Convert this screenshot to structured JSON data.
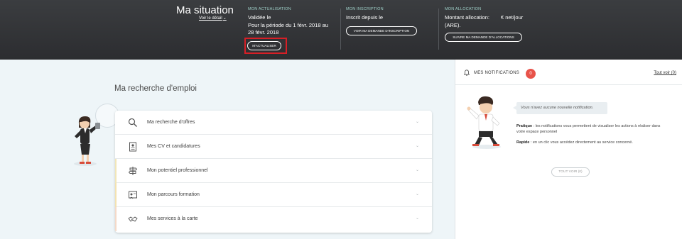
{
  "situation": {
    "title": "Ma situation",
    "detail_link": "Voir le détail",
    "actualisation": {
      "heading": "MON ACTUALISATION",
      "line1": "Validée le",
      "line2": "Pour la période du 1 févr. 2018 au",
      "line3": "28 févr. 2018",
      "button": "M'ACTUALISER"
    },
    "inscription": {
      "heading": "MON INSCRIPTION",
      "line1": "Inscrit depuis le",
      "button": "VOIR MA DEMANDE D'INSCRIPTION"
    },
    "allocation": {
      "heading": "MON ALLOCATION",
      "line1": "Montant allocation:",
      "line1b": "€ net/jour",
      "line2": "(ARE).",
      "button": "SUIVRE MA DEMANDE D'ALLOCATIONS"
    }
  },
  "main": {
    "title": "Ma recherche d'emploi",
    "items": [
      {
        "label": "Ma recherche d'offres",
        "icon": "search-icon",
        "accent": "#ffffff"
      },
      {
        "label": "Mes CV et candidatures",
        "icon": "cv-document-icon",
        "accent": "#ffffff"
      },
      {
        "label": "Mon potentiel professionnel",
        "icon": "signpost-icon",
        "accent": "#f1e6b8"
      },
      {
        "label": "Mon parcours formation",
        "icon": "training-icon",
        "accent": "#f3e2b0"
      },
      {
        "label": "Mes services à la carte",
        "icon": "handshake-icon",
        "accent": "#f4d9c8"
      }
    ]
  },
  "notifications": {
    "title": "MES NOTIFICATIONS",
    "count": "0",
    "see_all": "Tout voir (0)",
    "empty_message": "Vous n'avez aucune nouvelle notification.",
    "pratique_label": "Pratique",
    "pratique_text": " : les notifications vous permettent de visualiser les actions à réaliser dans votre espace personnel",
    "rapide_label": "Rapide",
    "rapide_text": " : en un clic vous accédez directement au service concerné.",
    "button": "TOUT VOIR (0)"
  },
  "colors": {
    "banner": "#2f3033",
    "badge": "#e8534a",
    "highlight": "#d61f26",
    "heading_accent": "#9fd0c8"
  }
}
